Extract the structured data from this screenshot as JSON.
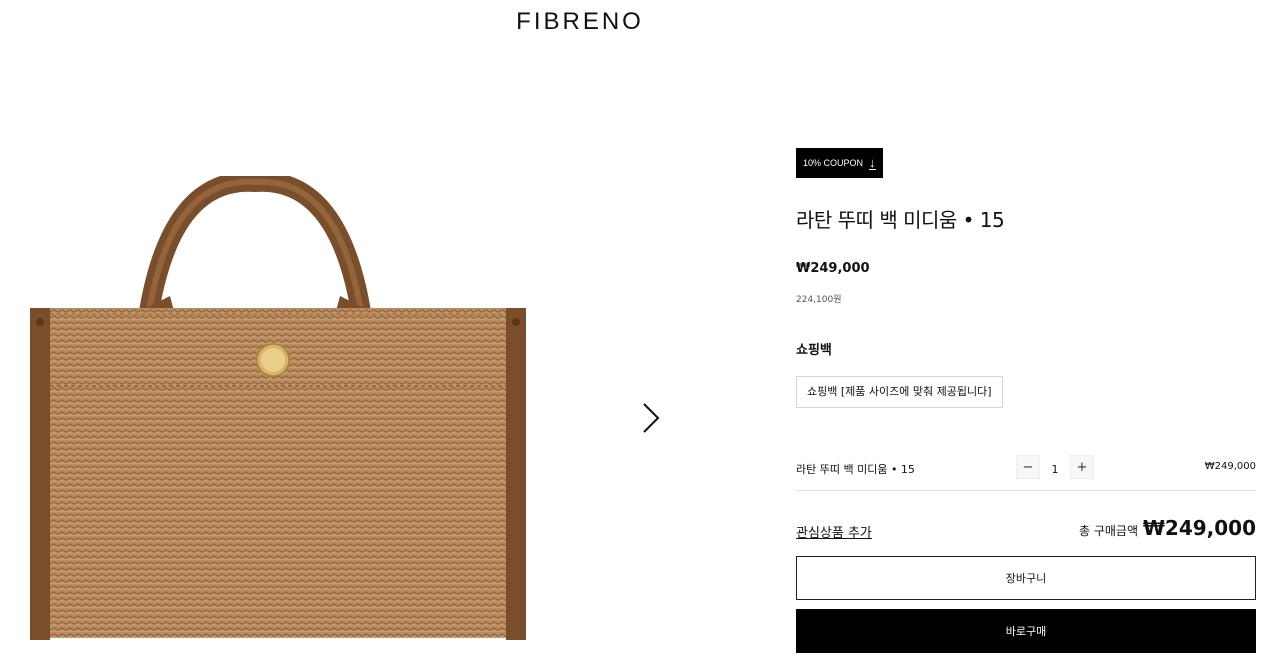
{
  "header": {
    "logo": "FIBRENO"
  },
  "product": {
    "coupon_label": "10% COUPON",
    "title": "라탄 뚜띠 백 미디움 • 15",
    "price": "₩249,000",
    "sub_price": "224,100원",
    "option_section_label": "쇼핑백",
    "option_button_label": "쇼핑백 [제품 사이즈에 맞춰 제공됩니다]"
  },
  "line_item": {
    "name": "라탄 뚜띠 백 미디움 • 15",
    "minus": "−",
    "quantity": "1",
    "plus": "+",
    "price": "₩249,000"
  },
  "summary": {
    "wishlist_label": "관심상품 추가",
    "total_label": "총 구매금액",
    "total_price": "₩249,000"
  },
  "actions": {
    "cart_label": "장바구니",
    "buy_label": "바로구매"
  },
  "icons": {
    "next": "chevron-right-icon",
    "download": "download-icon"
  },
  "colors": {
    "accent": "#000000",
    "raffia": "#b8865a",
    "leather": "#7a4e2b"
  }
}
